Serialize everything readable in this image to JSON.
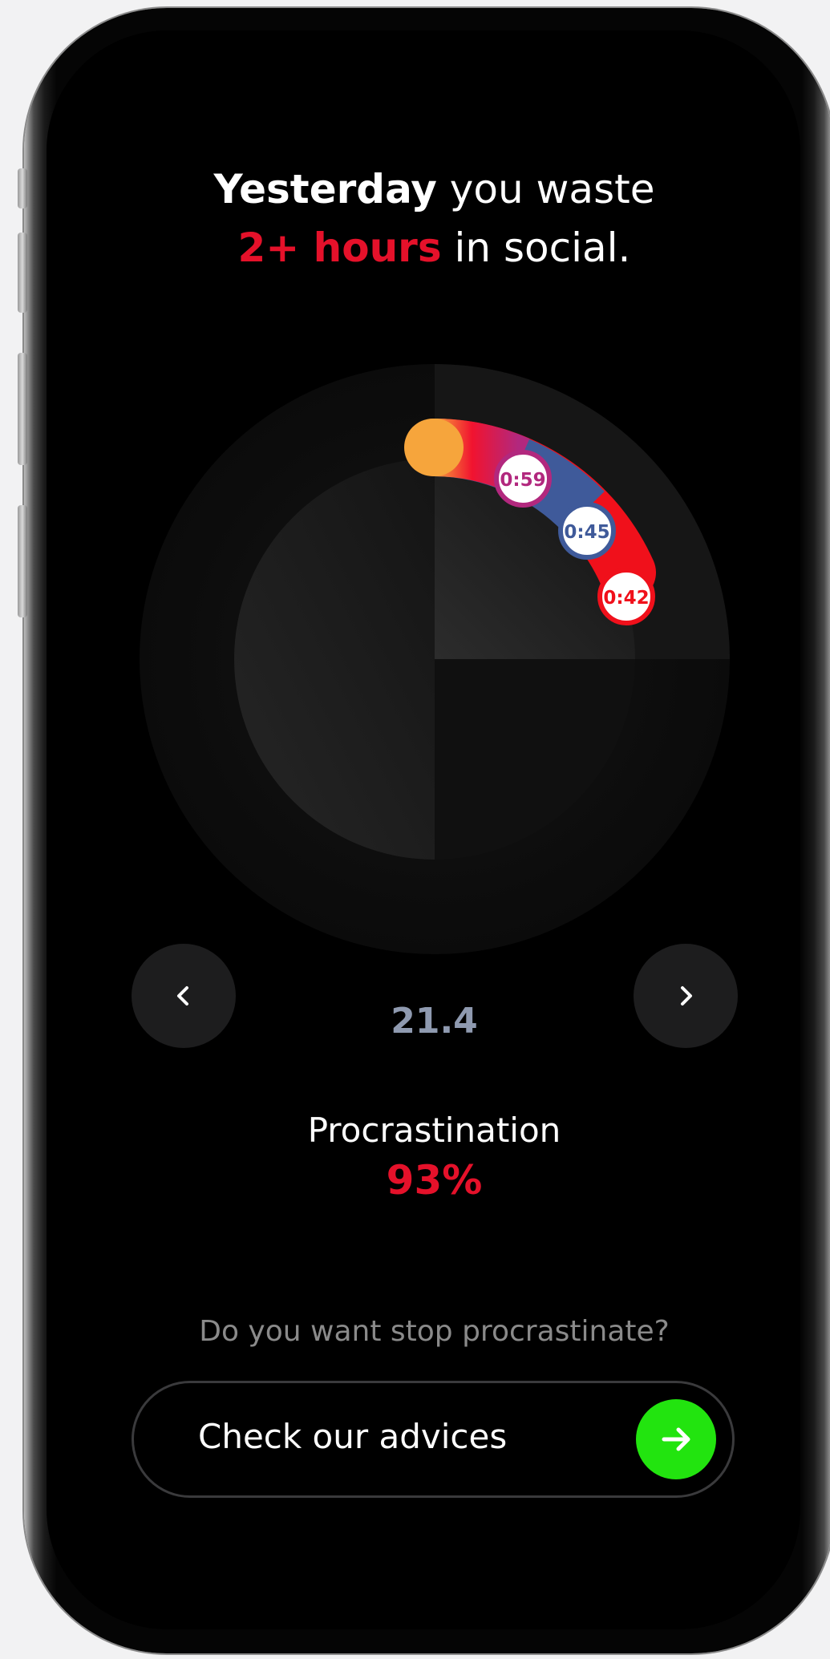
{
  "headline": {
    "line1_bold": "Yesterday",
    "line1_rest": " you waste",
    "line2_highlight": "2+ hours",
    "line2_rest": " in social."
  },
  "chart_data": {
    "type": "radial",
    "segments": [
      {
        "label": "0:59",
        "minutes": 59,
        "color_from": "#f6a53c",
        "color_to": "#b2287e"
      },
      {
        "label": "0:45",
        "minutes": 45,
        "color": "#3f5a9a"
      },
      {
        "label": "0:42",
        "minutes": 42,
        "color": "#f0101b"
      }
    ]
  },
  "navigation": {
    "prev_icon": "chevron-left-icon",
    "next_icon": "chevron-right-icon",
    "date": "21.4"
  },
  "metric": {
    "label": "Procrastination",
    "value": "93%"
  },
  "question": "Do you want stop procrastinate?",
  "cta": {
    "label": "Check our advices",
    "icon": "arrow-right-icon"
  },
  "colors": {
    "accent_red": "#e5112a",
    "cta_green": "#22e40f",
    "background": "#000000"
  }
}
